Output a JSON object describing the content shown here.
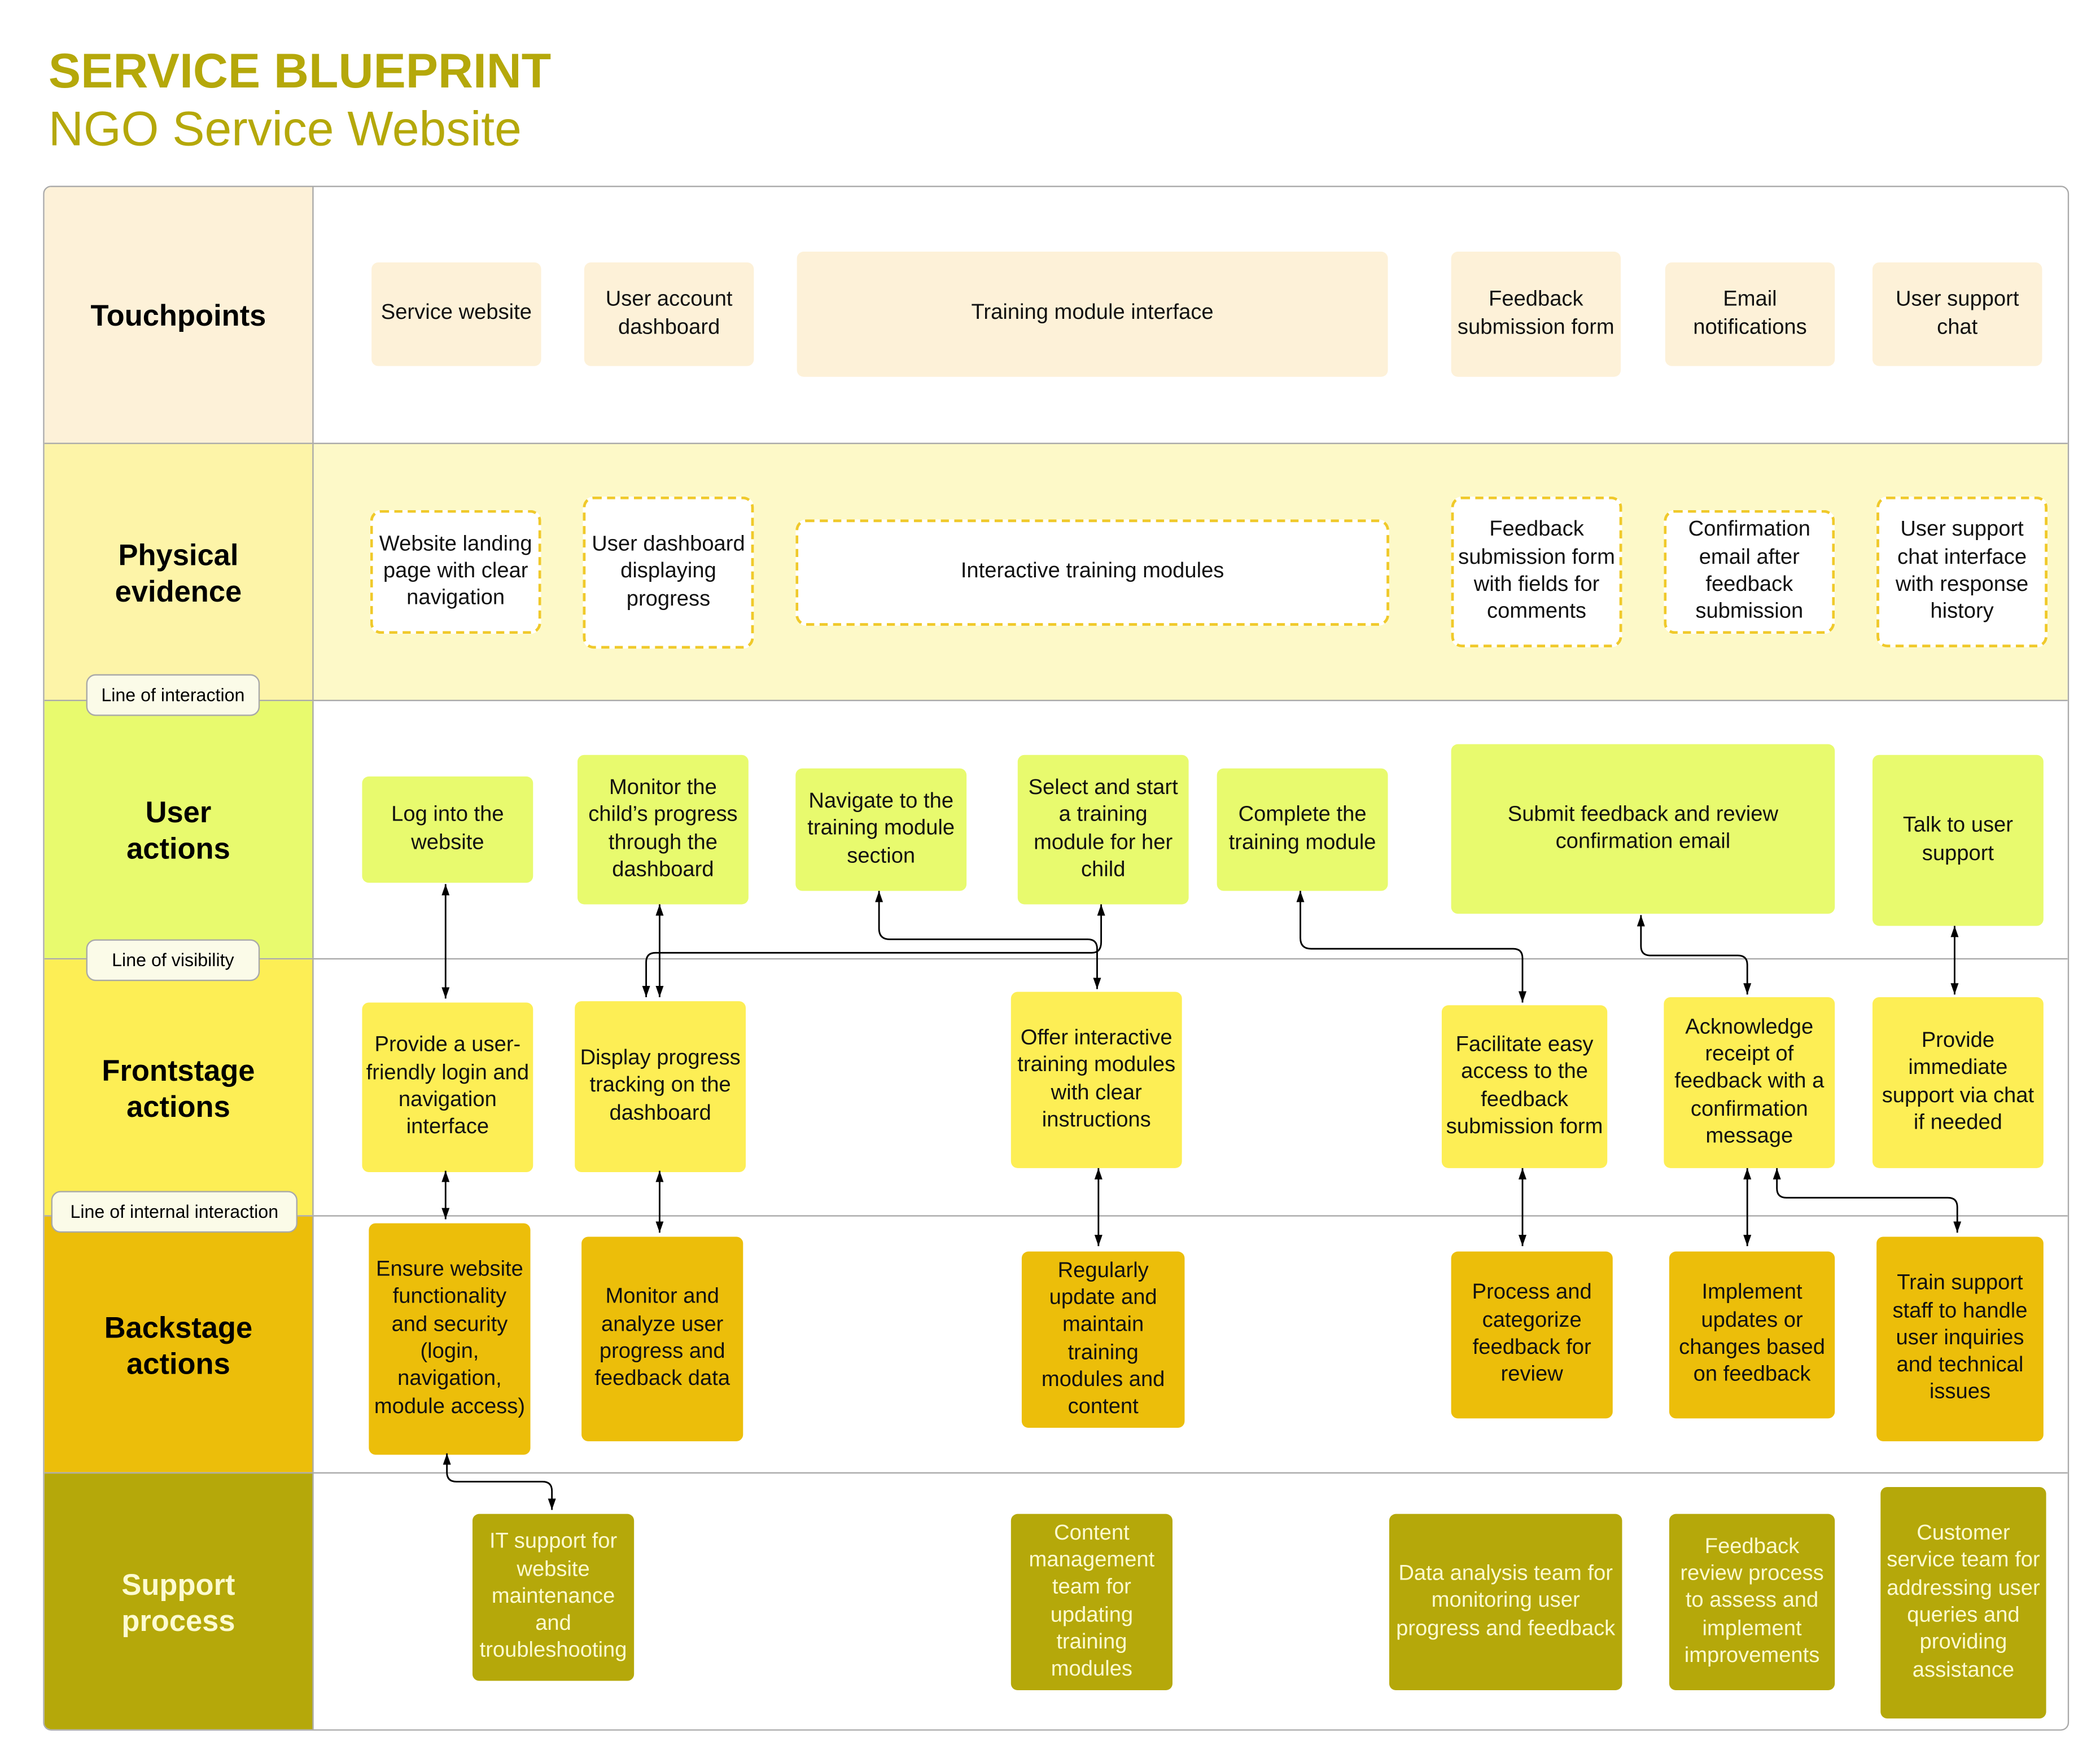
{
  "header": {
    "title": "SERVICE BLUEPRINT",
    "subtitle": "NGO Service Website"
  },
  "lines": {
    "interaction": "Line of interaction",
    "visibility": "Line of visibility",
    "internal": "Line of internal interaction"
  },
  "lanes": [
    {
      "id": "touchpoints",
      "label": "Touchpoints",
      "color": "#fdf1d8",
      "body_color": "#ffffff"
    },
    {
      "id": "physical-evidence",
      "label": "Physical evidence",
      "color": "#fdf4a8",
      "body_color": "#fdf9c8"
    },
    {
      "id": "user-actions",
      "label": "User actions",
      "color": "#e8fa6e",
      "body_color": "#ffffff"
    },
    {
      "id": "frontstage-actions",
      "label": "Frontstage actions",
      "color": "#fdee55",
      "body_color": "#ffffff"
    },
    {
      "id": "backstage-actions",
      "label": "Backstage actions",
      "color": "#ecbe0a",
      "body_color": "#ffffff"
    },
    {
      "id": "support-process",
      "label": "Support process",
      "color": "#b5a80a",
      "body_color": "#ffffff"
    }
  ],
  "touchpoints": [
    "Service website",
    "User account dashboard",
    "Training module interface",
    "Feedback submission form",
    "Email notifications",
    "User support chat"
  ],
  "physical_evidence": [
    "Website landing page with clear navigation",
    "User dashboard displaying progress",
    "Interactive training modules",
    "Feedback submission form with fields for comments",
    "Confirmation email after feedback submission",
    "User support chat interface with response history"
  ],
  "user_actions": [
    "Log into the website",
    "Monitor the child’s progress through the dashboard",
    "Navigate to the training module section",
    "Select and start a training module for her child",
    "Complete the training module",
    "Submit feedback and review confirmation email",
    "Talk to user support"
  ],
  "frontstage_actions": [
    "Provide a user-friendly login and navigation interface",
    "Display progress tracking on the dashboard",
    "Offer interactive training modules with clear instructions",
    "Facilitate easy access to the feedback submission form",
    "Acknowledge receipt of feedback with a confirmation message",
    "Provide immediate support via chat if needed"
  ],
  "backstage_actions": [
    "Ensure website functionality and security (login, navigation, module access)",
    "Monitor and analyze user progress and feedback data",
    "Regularly update and maintain training modules and content",
    "Process and categorize feedback for review",
    "Implement updates or changes based on feedback",
    "Train support staff to handle user inquiries and technical issues"
  ],
  "support_process": [
    "IT support for website maintenance and troubleshooting",
    "Content management team for updating training modules",
    "Data analysis team for monitoring user progress and feedback",
    "Feedback review process to assess and implement improvements",
    "Customer service team for addressing user queries and providing assistance"
  ]
}
